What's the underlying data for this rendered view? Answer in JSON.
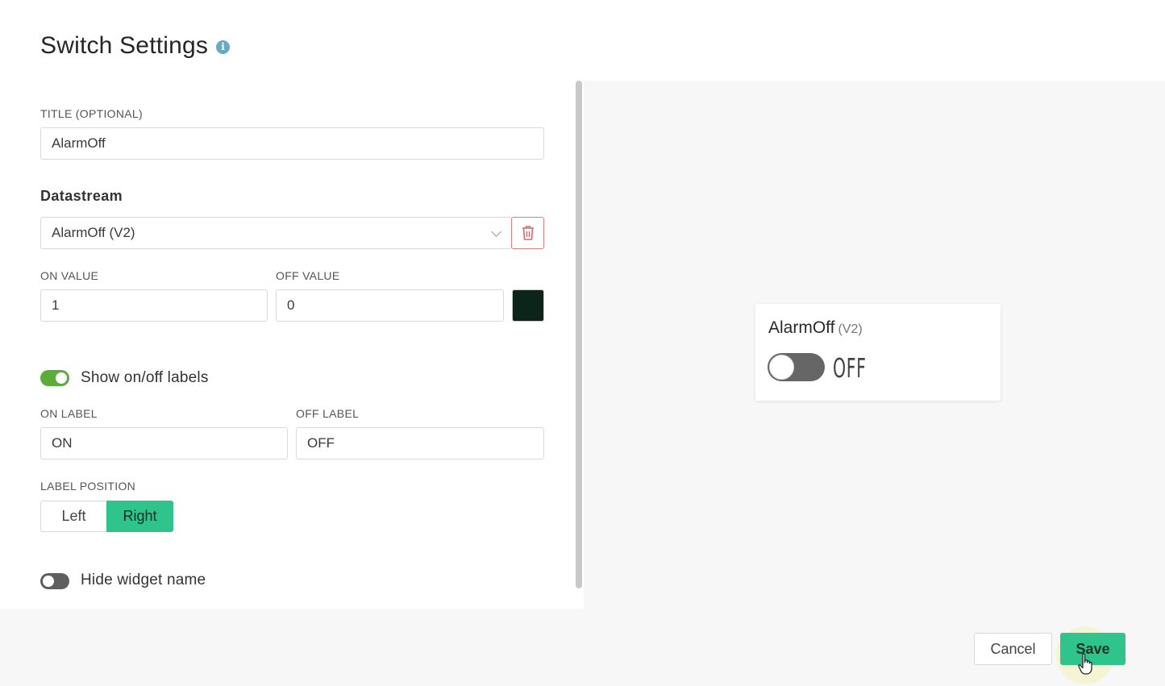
{
  "header": {
    "title": "Switch Settings",
    "info_icon": "info-icon"
  },
  "form": {
    "title_field": {
      "label": "TITLE (OPTIONAL)",
      "value": "AlarmOff"
    },
    "datastream": {
      "heading": "Datastream",
      "selected": "AlarmOff (V2)",
      "delete_icon": "trash-icon"
    },
    "on_value": {
      "label": "ON VALUE",
      "value": "1"
    },
    "off_value": {
      "label": "OFF VALUE",
      "value": "0"
    },
    "color": {
      "value": "#0c2419"
    },
    "show_labels": {
      "label": "Show on/off labels",
      "enabled": true
    },
    "on_label": {
      "label": "ON LABEL",
      "value": "ON"
    },
    "off_label": {
      "label": "OFF LABEL",
      "value": "OFF"
    },
    "label_position": {
      "label": "LABEL POSITION",
      "options": [
        "Left",
        "Right"
      ],
      "selected": "Right"
    },
    "hide_name": {
      "label": "Hide widget name",
      "enabled": false
    }
  },
  "preview": {
    "widget_name": "AlarmOff",
    "pin": "(V2)",
    "state_label": "OFF",
    "state_on": false
  },
  "footer": {
    "cancel_label": "Cancel",
    "save_label": "Save"
  },
  "colors": {
    "accent": "#2ec48c",
    "toggle_on": "#5aad3b",
    "danger": "#e37b7b"
  }
}
